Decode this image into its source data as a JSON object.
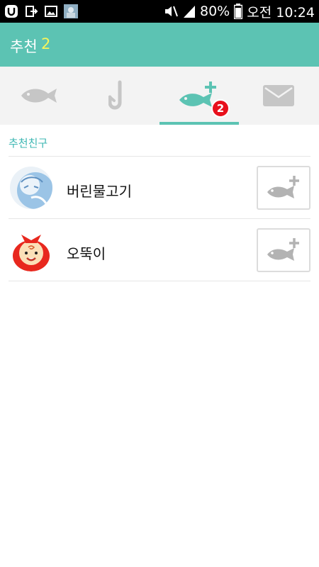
{
  "status_bar": {
    "battery_percent": "80%",
    "time": "오전 10:24",
    "icons": [
      "u-app-icon",
      "exit-icon",
      "image-icon",
      "photo-thumbnail-icon",
      "mute-icon",
      "signal-icon",
      "battery-icon"
    ]
  },
  "header": {
    "title": "추천",
    "count": "2"
  },
  "tabs": [
    {
      "icon": "fish-icon",
      "active": false
    },
    {
      "icon": "hook-icon",
      "active": false
    },
    {
      "icon": "fish-add-icon",
      "active": true,
      "badge": "2"
    },
    {
      "icon": "mail-icon",
      "active": false
    }
  ],
  "section": {
    "title": "추천친구"
  },
  "friends": [
    {
      "name": "버린물고기",
      "avatar": "drawing-avatar",
      "action_icon": "fish-add-icon"
    },
    {
      "name": "오뚝이",
      "avatar": "doll-avatar",
      "action_icon": "fish-add-icon"
    }
  ],
  "colors": {
    "accent": "#5cc3b3",
    "count": "#f5f55c",
    "badge": "#e8101c",
    "section_title": "#3db7b3",
    "icon_gray": "#c6c6c6"
  }
}
